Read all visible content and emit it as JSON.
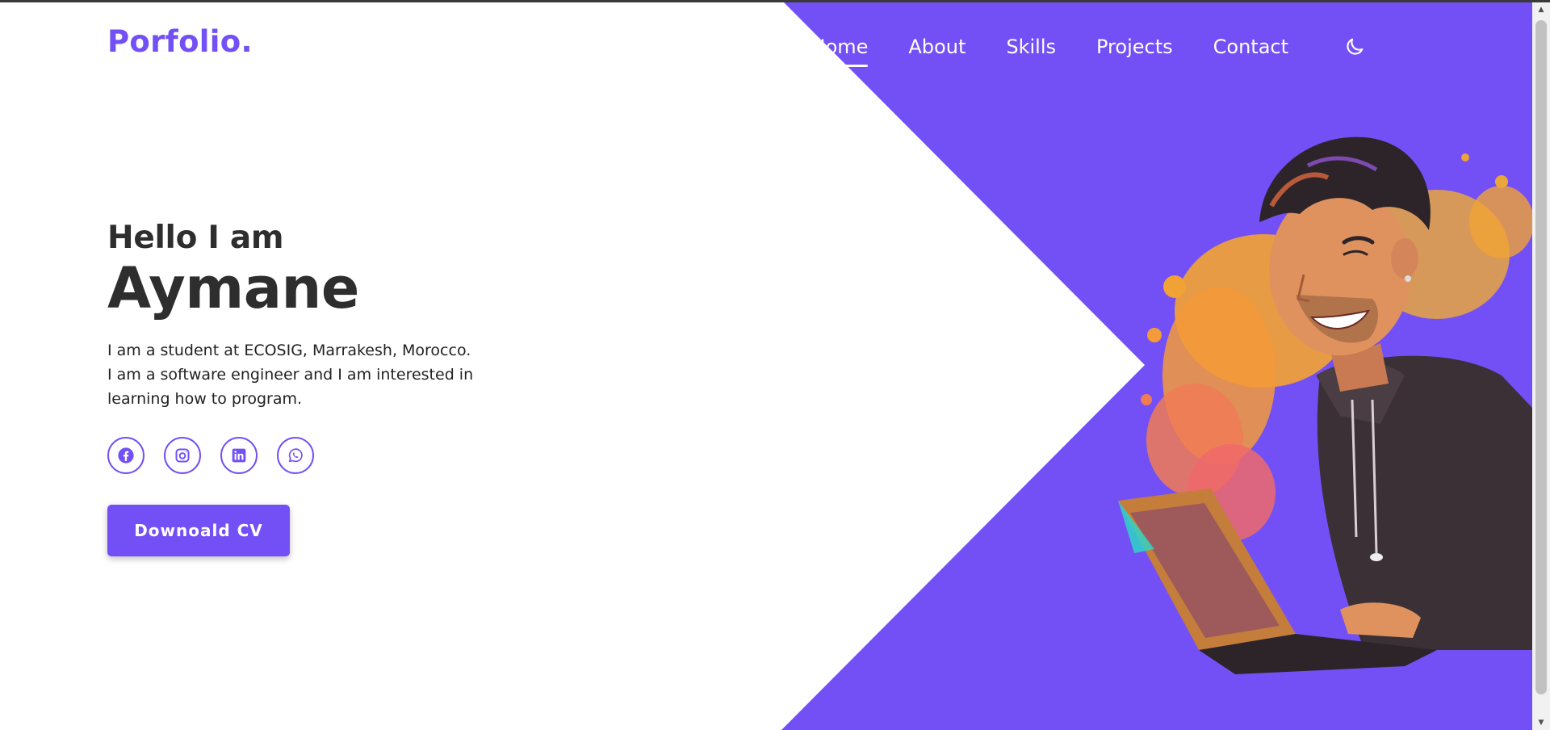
{
  "logo": "Porfolio.",
  "nav": {
    "items": [
      "Home",
      "About",
      "Skills",
      "Projects",
      "Contact"
    ],
    "active": "Home",
    "theme_icon": "moon-icon"
  },
  "hero": {
    "greeting": "Hello I am",
    "name": "Aymane",
    "bio_lines": [
      "I am a student at ECOSIG, Marrakesh, Morocco.",
      "I am a software engineer and I am interested in",
      "learning how to program."
    ],
    "socials": [
      "facebook-icon",
      "instagram-icon",
      "linkedin-icon",
      "whatsapp-icon"
    ],
    "cv_button": "Downoald CV"
  },
  "colors": {
    "accent": "#7350f5",
    "text": "#2e2e2e",
    "background": "#ffffff"
  }
}
